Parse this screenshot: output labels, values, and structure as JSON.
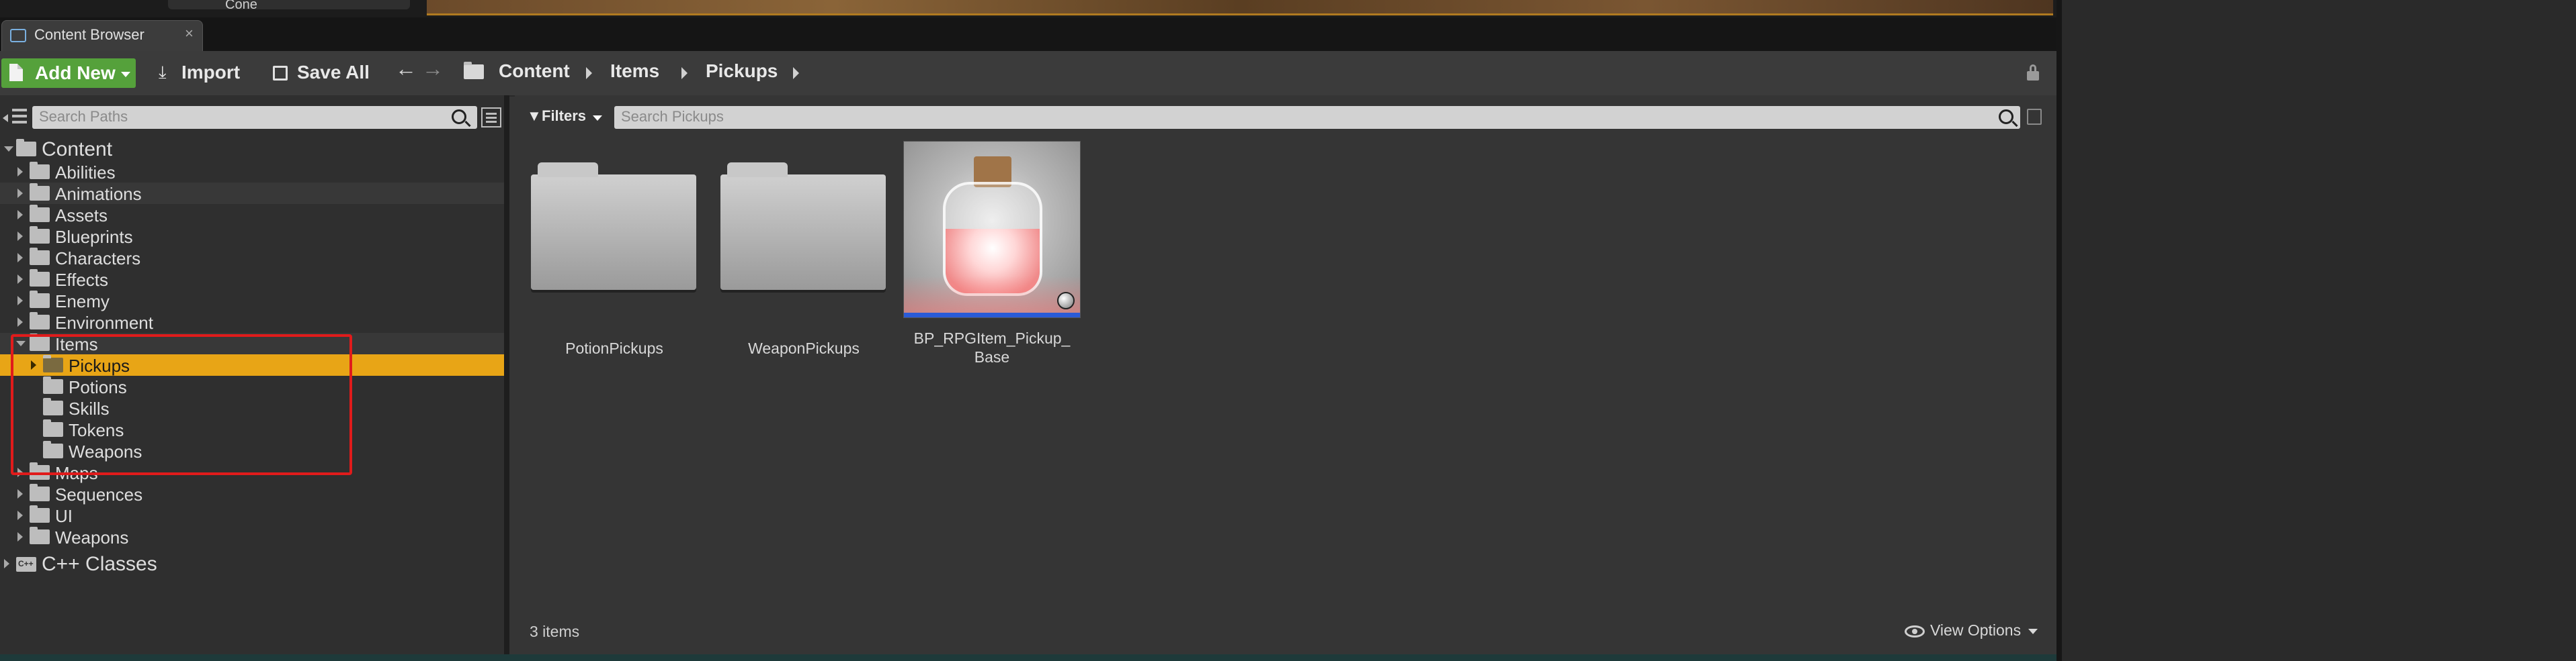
{
  "window": {
    "tab_title": "Content Browser",
    "tab_close": "×",
    "top_asset_label": "Cone"
  },
  "toolbar": {
    "add_new": "Add New",
    "import": "Import",
    "save_all": "Save All",
    "breadcrumb": [
      "Content",
      "Items",
      "Pickups"
    ]
  },
  "sources": {
    "search_placeholder": "Search Paths",
    "root": "Content",
    "folders": [
      {
        "label": "Abilities"
      },
      {
        "label": "Animations"
      },
      {
        "label": "Assets"
      },
      {
        "label": "Blueprints"
      },
      {
        "label": "Characters"
      },
      {
        "label": "Effects"
      },
      {
        "label": "Enemy"
      },
      {
        "label": "Environment"
      },
      {
        "label": "Items"
      },
      {
        "label": "Pickups"
      },
      {
        "label": "Potions"
      },
      {
        "label": "Skills"
      },
      {
        "label": "Tokens"
      },
      {
        "label": "Weapons"
      },
      {
        "label": "Maps"
      },
      {
        "label": "Sequences"
      },
      {
        "label": "UI"
      },
      {
        "label": "Weapons"
      }
    ],
    "cpp_root": "C++ Classes",
    "cpp_badge": "C++"
  },
  "assets": {
    "filters_label": "Filters",
    "search_placeholder": "Search Pickups",
    "items": [
      {
        "name": "PotionPickups",
        "kind": "folder"
      },
      {
        "name": "WeaponPickups",
        "kind": "folder"
      },
      {
        "name": "BP_RPGItem_Pickup_Base",
        "name_line1": "BP_RPGItem_Pickup_",
        "name_line2": "Base",
        "kind": "blueprint"
      }
    ],
    "item_count": "3 items",
    "view_options": "View Options"
  },
  "colors": {
    "selected_row": "#e8a516",
    "add_new_green": "#55a13b",
    "highlight_box": "#e01b1b"
  }
}
